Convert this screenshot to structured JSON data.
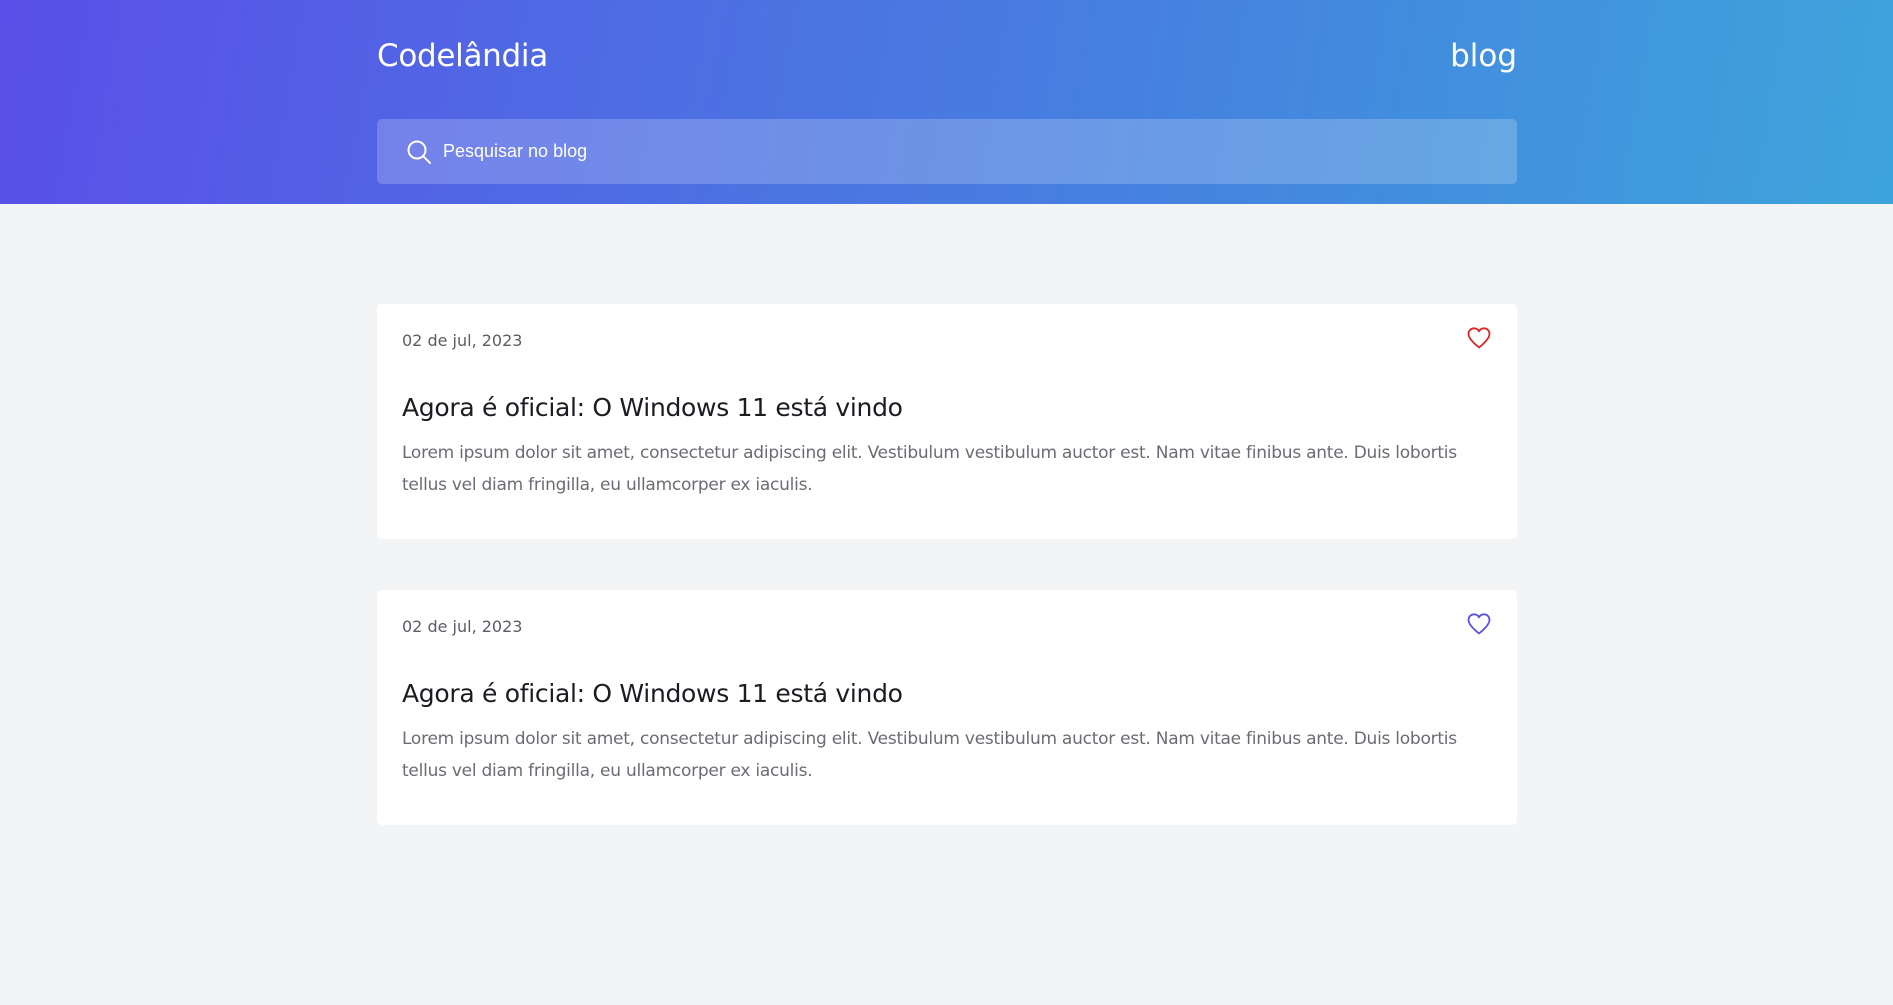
{
  "header": {
    "brand": "Codelândia",
    "nav_link": "blog"
  },
  "search": {
    "placeholder": "Pesquisar no blog",
    "icon": "search-icon"
  },
  "colors": {
    "gradient_start": "#5a4fe8",
    "gradient_end": "#3ea4dc",
    "heart_liked": "#e02424",
    "heart_default": "#5b4fe8"
  },
  "posts": [
    {
      "date": "02 de jul, 2023",
      "title": "Agora é oficial: O Windows 11 está vindo",
      "excerpt": "Lorem ipsum dolor sit amet, consectetur adipiscing elit. Vestibulum vestibulum auctor est. Nam vitae finibus ante. Duis lobortis tellus vel diam fringilla, eu ullamcorper ex iaculis.",
      "liked": true
    },
    {
      "date": "02 de jul, 2023",
      "title": "Agora é oficial: O Windows 11 está vindo",
      "excerpt": "Lorem ipsum dolor sit amet, consectetur adipiscing elit. Vestibulum vestibulum auctor est. Nam vitae finibus ante. Duis lobortis tellus vel diam fringilla, eu ullamcorper ex iaculis.",
      "liked": false
    }
  ]
}
